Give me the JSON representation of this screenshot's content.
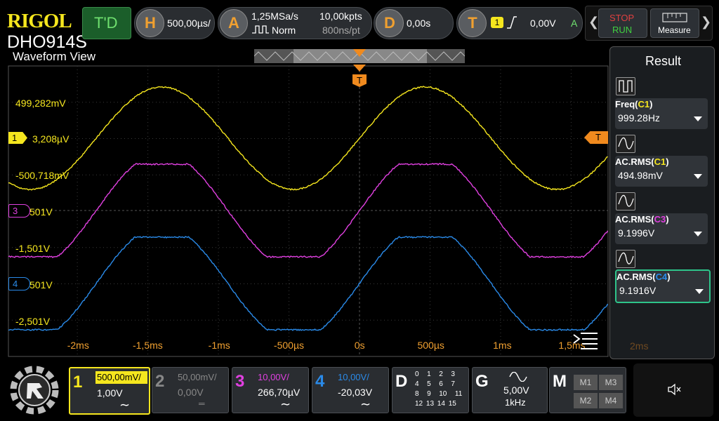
{
  "brand": {
    "logo": "RIGOL",
    "model": "DHO914S"
  },
  "status": {
    "td": "T'D"
  },
  "horizontal": {
    "letter": "H",
    "timebase": "500,00µs/"
  },
  "acquire": {
    "letter": "A",
    "sample_rate": "1,25MSa/s",
    "mode": "Norm",
    "points": "10,00kpts",
    "time_per_pt": "800ns/pt"
  },
  "delay": {
    "letter": "D",
    "value": "0,00s"
  },
  "trigger": {
    "letter": "T",
    "source": "1",
    "level": "0,00V",
    "mode": "A"
  },
  "toolbar": {
    "stop": "STOP",
    "run": "RUN",
    "measure": "Measure"
  },
  "view": {
    "title": "Waveform View"
  },
  "y_labels": {
    "l1": "499,282mV",
    "l2": "3,208µV",
    "l3": "-500,718mV",
    "l4": "501V",
    "l5": "-1,501V",
    "l6": "501V",
    "l7": "-2,501V"
  },
  "markers": {
    "ch1": "1",
    "ch3": "3",
    "ch4": "4",
    "trig": "T"
  },
  "x_ticks": [
    "-2ms",
    "-1,5ms",
    "-1ms",
    "-500µs",
    "0s",
    "500µs",
    "1ms",
    "1,5ms"
  ],
  "result": {
    "title": "Result",
    "items": [
      {
        "name": "Freq(",
        "ch": "C1",
        "close": ")",
        "value": "999.28Hz",
        "ch_color": "#f5e61e"
      },
      {
        "name": "AC.RMS(",
        "ch": "C1",
        "close": ")",
        "value": "494.98mV",
        "ch_color": "#f5e61e"
      },
      {
        "name": "AC.RMS(",
        "ch": "C3",
        "close": ")",
        "value": "9.1996V",
        "ch_color": "#e040e0"
      },
      {
        "name": "AC.RMS(",
        "ch": "C4",
        "close": ")",
        "value": "9.1916V",
        "ch_color": "#2a8ae8"
      }
    ],
    "ghost_tick": "2ms"
  },
  "channels": {
    "c1": {
      "num": "1",
      "scale": "500,00mV/",
      "offset": "1,00V",
      "coupling": "∼"
    },
    "c2": {
      "num": "2",
      "scale": "50,00mV/",
      "offset": "0,00V",
      "coupling": "═"
    },
    "c3": {
      "num": "3",
      "scale": "10,00V/",
      "offset": "266,70µV",
      "coupling": "∼"
    },
    "c4": {
      "num": "4",
      "scale": "10,00V/",
      "offset": "-20,03V",
      "coupling": "∼"
    }
  },
  "digital": {
    "letter": "D",
    "rows": [
      "0  1  2  3",
      "4  5  6  7",
      "8  9  10  11",
      "12 13 14 15"
    ]
  },
  "generator": {
    "letter": "G",
    "amp": "5,00V",
    "freq": "1kHz"
  },
  "math": {
    "letter": "M",
    "m1": "M1",
    "m2": "M2",
    "m3": "M3",
    "m4": "M4"
  },
  "colors": {
    "ch1": "#f5e61e",
    "ch3": "#e040e0",
    "ch4": "#2a8ae8",
    "trigger": "#f08a1e"
  }
}
